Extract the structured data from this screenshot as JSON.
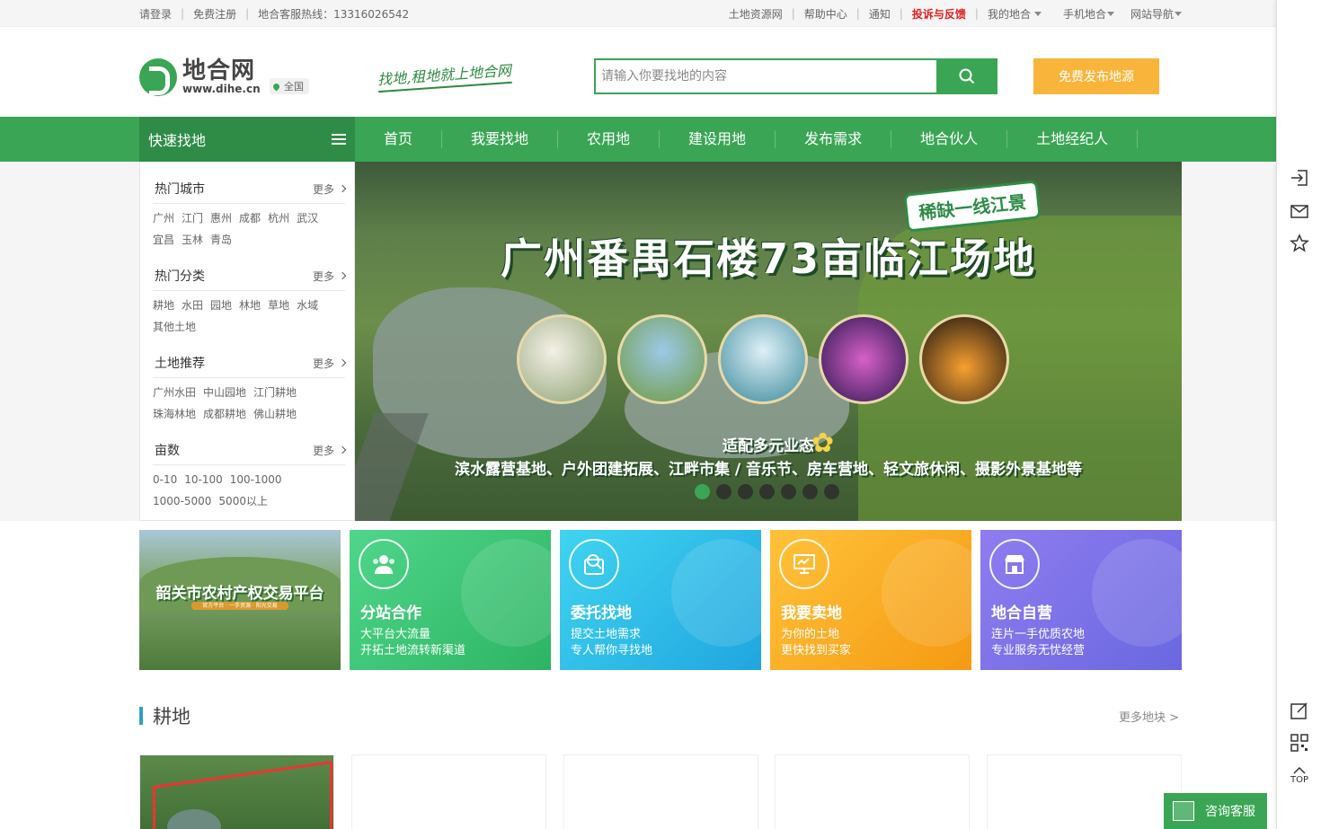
{
  "topbar": {
    "login": "请登录",
    "register": "免费注册",
    "hotline": "地合客服热线：13316026542",
    "links": [
      "土地资源网",
      "帮助中心",
      "通知"
    ],
    "complaint": "投诉与反馈",
    "my_dihe": "我的地合",
    "mobile": "手机地合",
    "site_nav": "网站导航"
  },
  "header": {
    "logo_cn": "地合网",
    "logo_en": "www.dihe.cn",
    "region": "全国",
    "slogan": "找地,租地就上地合网",
    "search_placeholder": "请输入你要找地的内容",
    "publish": "免费发布地源"
  },
  "nav": {
    "quick": "快速找地",
    "items": [
      "首页",
      "我要找地",
      "农用地",
      "建设用地",
      "发布需求",
      "地合伙人",
      "土地经纪人"
    ]
  },
  "sidebar": {
    "more": "更多",
    "categories": [
      {
        "title": "热门城市",
        "links": [
          "广州",
          "江门",
          "惠州",
          "成都",
          "杭州",
          "武汉",
          "宜昌",
          "玉林",
          "青岛"
        ]
      },
      {
        "title": "热门分类",
        "links": [
          "耕地",
          "水田",
          "园地",
          "林地",
          "草地",
          "水域",
          "其他土地"
        ]
      },
      {
        "title": "土地推荐",
        "links": [
          "广州水田",
          "中山园地",
          "江门耕地",
          "珠海林地",
          "成都耕地",
          "佛山耕地"
        ]
      },
      {
        "title": "亩数",
        "links": [
          "0-10",
          "10-100",
          "100-1000",
          "1000-5000",
          "5000以上"
        ]
      }
    ]
  },
  "banner": {
    "tag": "稀缺一线江景",
    "title": "广州番禺石楼73亩临江场地",
    "sub1": "适配多元业态",
    "sub2": "滨水露营基地、户外团建拓展、江畔市集 / 音乐节、房车营地、轻文旅休闲、摄影外景基地等",
    "slide_count": 7,
    "active_slide": 0
  },
  "cards": {
    "photo": {
      "title": "韶关市农村产权交易平台",
      "band": "官方平台 · 一手资源 · 阳光交易"
    },
    "items": [
      {
        "title": "分站合作",
        "line1": "大平台大流量",
        "line2": "开拓土地流转新渠道",
        "icon": "users-icon"
      },
      {
        "title": "委托找地",
        "line1": "提交土地需求",
        "line2": "专人帮你寻找地",
        "icon": "search-doc-icon"
      },
      {
        "title": "我要卖地",
        "line1": "为你的土地",
        "line2": "更快找到买家",
        "icon": "monitor-icon"
      },
      {
        "title": "地合自营",
        "line1": "连片一手优质农地",
        "line2": "专业服务无忧经营",
        "icon": "store-icon"
      }
    ]
  },
  "section": {
    "title": "耕地",
    "more": "更多地块 >"
  },
  "service": {
    "label": "咨询客服"
  },
  "rail": {
    "top_label": "TOP"
  },
  "colors": {
    "brand_green": "#3aa655",
    "dark_green": "#2e8c47",
    "publish_orange": "#f9b53b",
    "complaint_red": "#e02020"
  }
}
